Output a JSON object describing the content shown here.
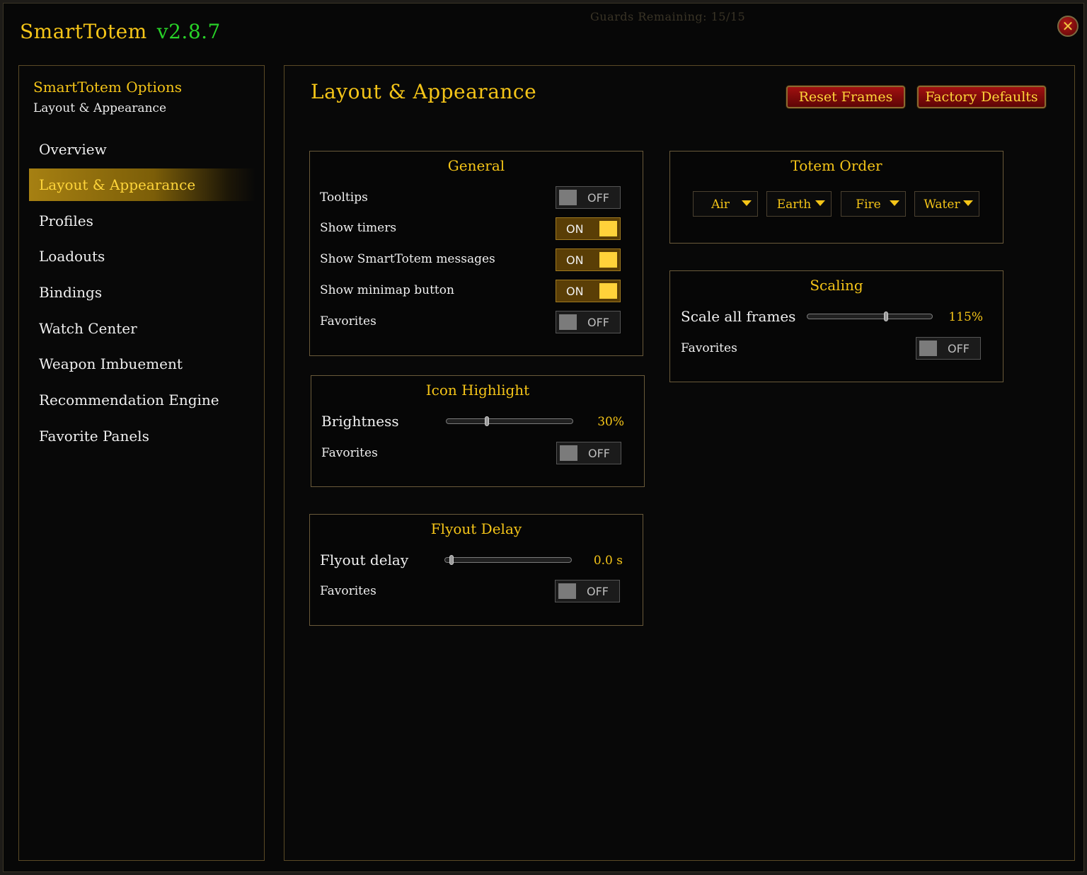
{
  "app": {
    "title": "SmartTotem",
    "version": "v2.8.7",
    "background_hint": "Guards Remaining: 15/15",
    "close_icon": "close-icon"
  },
  "colors": {
    "gold": "#f5c518",
    "version_green": "#28d228",
    "button_red": "#a01010",
    "toggle_on": "#ffd23a"
  },
  "sidebar": {
    "title": "SmartTotem Options",
    "subtitle": "Layout & Appearance",
    "items": [
      {
        "label": "Overview",
        "active": false
      },
      {
        "label": "Layout & Appearance",
        "active": true
      },
      {
        "label": "Profiles",
        "active": false
      },
      {
        "label": "Loadouts",
        "active": false
      },
      {
        "label": "Bindings",
        "active": false
      },
      {
        "label": "Watch Center",
        "active": false
      },
      {
        "label": "Weapon Imbuement",
        "active": false
      },
      {
        "label": "Recommendation Engine",
        "active": false
      },
      {
        "label": "Favorite Panels",
        "active": false
      }
    ]
  },
  "main": {
    "title": "Layout & Appearance",
    "buttons": {
      "reset": "Reset Frames",
      "factory": "Factory Defaults"
    }
  },
  "general": {
    "title": "General",
    "rows": [
      {
        "label": "Tooltips",
        "state": "OFF"
      },
      {
        "label": "Show timers",
        "state": "ON"
      },
      {
        "label": "Show SmartTotem messages",
        "state": "ON"
      },
      {
        "label": "Show minimap button",
        "state": "ON"
      },
      {
        "label": "Favorites",
        "state": "OFF"
      }
    ]
  },
  "icon_highlight": {
    "title": "Icon Highlight",
    "slider_label": "Brightness",
    "slider_value": "30%",
    "slider_fraction": 0.32,
    "favorites_label": "Favorites",
    "favorites_state": "OFF"
  },
  "flyout": {
    "title": "Flyout Delay",
    "slider_label": "Flyout delay",
    "slider_value": "0.0 s",
    "slider_fraction": 0.05,
    "favorites_label": "Favorites",
    "favorites_state": "OFF"
  },
  "totem_order": {
    "title": "Totem Order",
    "items": [
      "Air",
      "Earth",
      "Fire",
      "Water"
    ]
  },
  "scaling": {
    "title": "Scaling",
    "slider_label": "Scale all frames",
    "slider_value": "115%",
    "slider_fraction": 0.63,
    "favorites_label": "Favorites",
    "favorites_state": "OFF"
  }
}
